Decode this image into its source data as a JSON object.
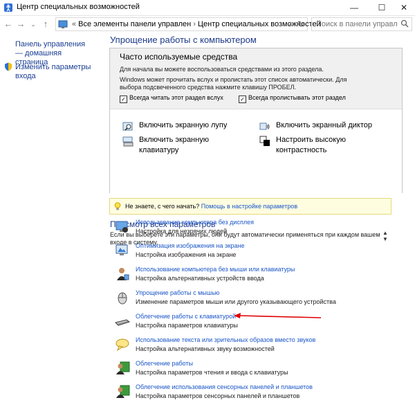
{
  "window": {
    "title": "Центр специальных возможностей",
    "minimize": "—",
    "maximize": "☐",
    "close": "✕"
  },
  "address": {
    "crumbs": [
      "Все элементы панели управлен",
      "Центр специальных возможностей"
    ],
    "search_placeholder": "Поиск в панели управления"
  },
  "sidebar": {
    "home_link": "Панель управления — домашняя страница",
    "logon_link": "Изменить параметры входа"
  },
  "main": {
    "heading": "Упрощение работы с компьютером",
    "panel_title": "Часто используемые средства",
    "panel_text1": "Для начала вы можете воспользоваться средствами из этого раздела.",
    "panel_text2": "Windows может прочитать вслух и пролистать этот список автоматически. Для выбора подсвеченного средства нажмите клавишу ПРОБЕЛ.",
    "check_read": "Всегда читать этот раздел вслух",
    "check_scan": "Всегда пролистывать этот раздел",
    "tools": {
      "magnifier": "Включить экранную лупу",
      "narrator": "Включить экранный диктор",
      "osk_line1": "Включить экранную",
      "osk_line2": "клавиатуру",
      "contrast_line1": "Настроить высокую",
      "contrast_line2": "контрастность"
    },
    "tip_text": "Не знаете, с чего начать?",
    "tip_link": "Помощь в настройке параметров",
    "browse_heading": "Просмотр всех параметров",
    "browse_desc": "Если вы выберете эти параметры, они будут автоматически применяться при каждом вашем входе в систему.",
    "items": [
      {
        "link": "Использование компьютера без дисплея",
        "sub": "Настройка для незрячих людей"
      },
      {
        "link": "Оптимизация изображения на экране",
        "sub": "Настройка изображения на экране"
      },
      {
        "link": "Использование компьютера без мыши или клавиатуры",
        "sub": "Настройка альтернативных устройств ввода"
      },
      {
        "link": "Упрощение работы с мышью",
        "sub": "Изменение параметров мыши или другого указывающего устройства"
      },
      {
        "link": "Облегчение работы с клавиатурой",
        "sub": "Настройка параметров клавиатуры"
      },
      {
        "link": "Использование текста или зрительных образов вместо звуков",
        "sub": "Настройка альтернативных звуку возможностей"
      },
      {
        "link": "Облегчение работы",
        "sub": "Настройка параметров чтения и ввода с клавиатуры"
      },
      {
        "link": "Облегчение использования сенсорных панелей и планшетов",
        "sub": "Настройка параметров сенсорных панелей и планшетов"
      }
    ]
  },
  "colors": {
    "link": "#1a56c8",
    "heading": "#1e3a8a",
    "annotation_arrow": "#e00000"
  }
}
